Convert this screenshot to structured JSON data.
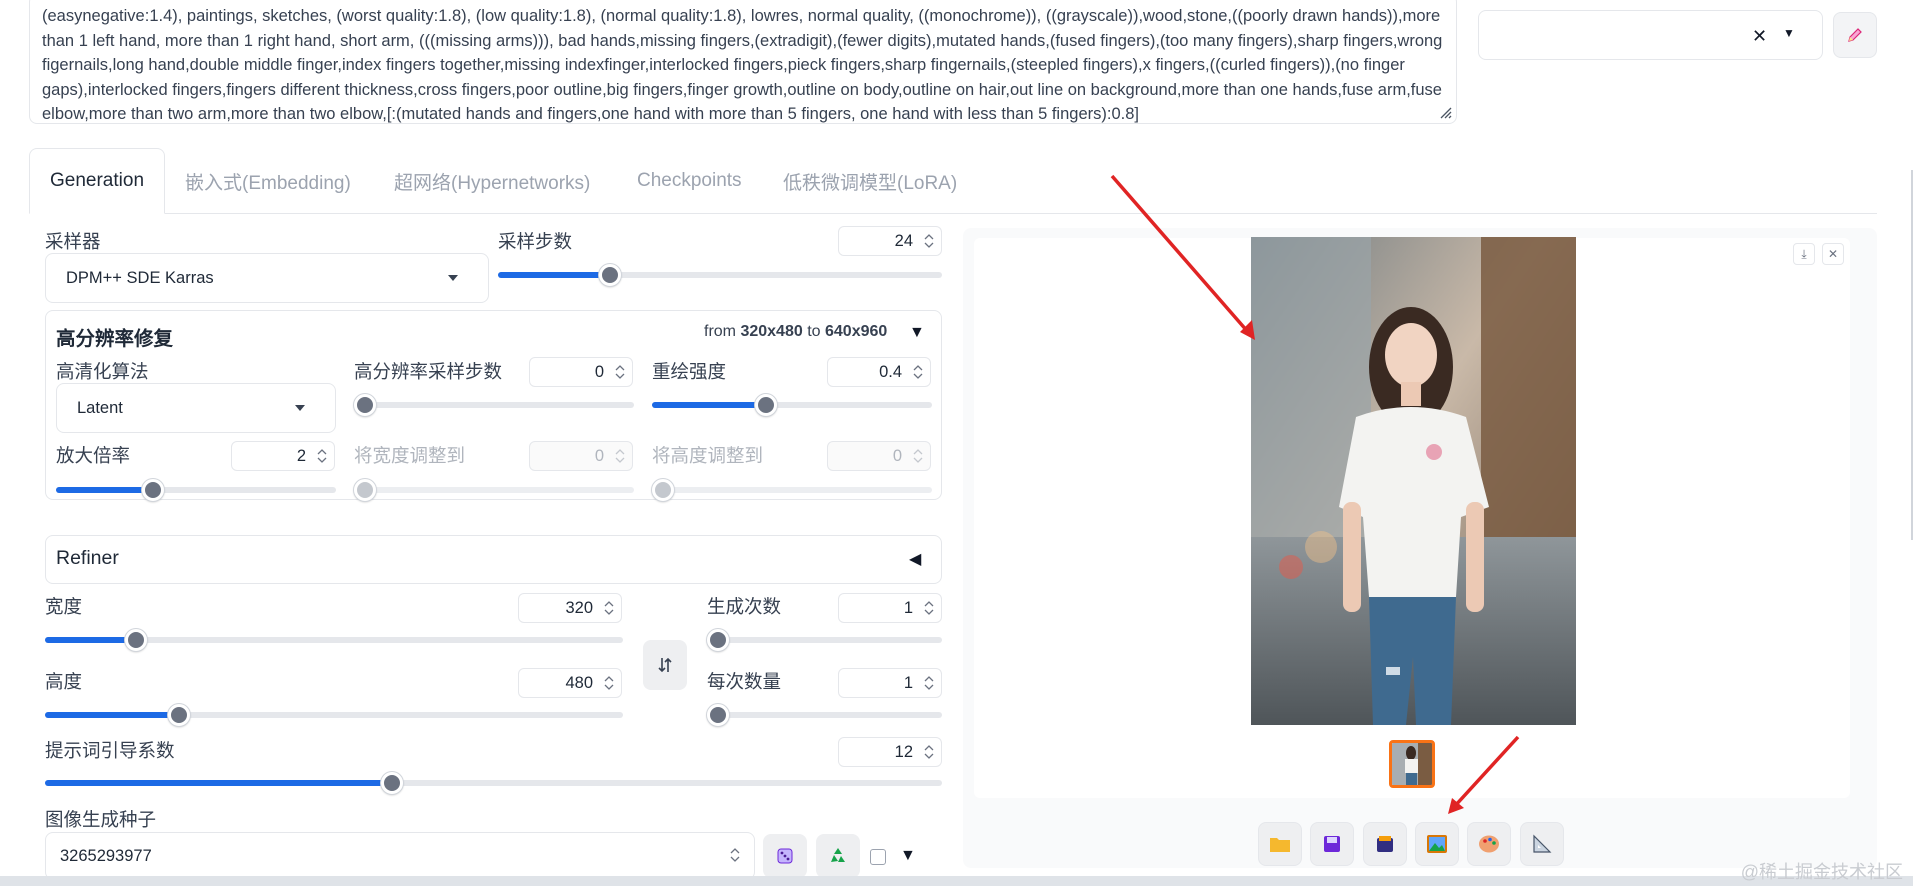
{
  "prompt": {
    "negative_text": "(easynegative:1.4), paintings, sketches, (worst quality:1.8), (low quality:1.8), (normal quality:1.8), lowres, normal quality, ((monochrome)), ((grayscale)),wood,stone,((poorly drawn hands)),more than 1 left hand, more than 1 right hand, short arm, (((missing arms))), bad hands,missing fingers,(extradigit),(fewer digits),mutated hands,(fused fingers),(too many fingers),sharp fingers,wrong figernails,long hand,double middle finger,index fingers together,missing indexfinger,interlocked fingers,pieck fingers,sharp fingernails,(steepled fingers),x fingers,((curled fingers)),(no finger gaps),interlocked fingers,fingers different thickness,cross fingers,poor outline,big fingers,finger growth,outline on body,outline on hair,out line on background,more than one hands,fuse arm,fuse elbow,more than two arm,more than two elbow,[:(mutated hands and fingers,one hand with more than 5 fingers, one hand with less than 5 fingers):0.8]"
  },
  "tabs": [
    {
      "label": "Generation",
      "active": true
    },
    {
      "label": "嵌入式(Embedding)",
      "active": false
    },
    {
      "label": "超网络(Hypernetworks)",
      "active": false
    },
    {
      "label": "Checkpoints",
      "active": false
    },
    {
      "label": "低秩微调模型(LoRA)",
      "active": false
    }
  ],
  "sampler": {
    "label": "采样器",
    "value": "DPM++ SDE Karras"
  },
  "steps": {
    "label": "采样步数",
    "value": "24",
    "fraction": 0.24
  },
  "hires": {
    "title": "高分辨率修复",
    "from_prefix": "from",
    "from_value": "320x480",
    "to_prefix": "to",
    "to_value": "640x960",
    "upscaler": {
      "label": "高清化算法",
      "value": "Latent"
    },
    "hires_steps": {
      "label": "高分辨率采样步数",
      "value": "0",
      "fraction": 0.0
    },
    "denoise": {
      "label": "重绘强度",
      "value": "0.4",
      "fraction": 0.4
    },
    "upscale_by": {
      "label": "放大倍率",
      "value": "2",
      "fraction": 0.333
    },
    "resize_width": {
      "label": "将宽度调整到",
      "value": "0",
      "fraction": 0.0
    },
    "resize_height": {
      "label": "将高度调整到",
      "value": "0",
      "fraction": 0.0
    }
  },
  "refiner": {
    "title": "Refiner"
  },
  "width": {
    "label": "宽度",
    "value": "320",
    "fraction": 0.143
  },
  "height": {
    "label": "高度",
    "value": "480",
    "fraction": 0.222
  },
  "batch_count": {
    "label": "生成次数",
    "value": "1",
    "fraction": 0.0
  },
  "batch_size": {
    "label": "每次数量",
    "value": "1",
    "fraction": 0.0
  },
  "cfg": {
    "label": "提示词引导系数",
    "value": "12",
    "fraction": 0.384
  },
  "seed": {
    "label": "图像生成种子",
    "value": "3265293977"
  },
  "watermark": "@稀土掘金技术社区",
  "colors": {
    "accent": "#1d6ae5",
    "thumb_border": "#f97316",
    "arrow": "#e02424"
  },
  "icons": [
    "pencil-icon",
    "swap-icon",
    "dice-icon",
    "recycle-icon",
    "folder-icon",
    "save-icon",
    "zip-icon",
    "image-icon",
    "palette-icon",
    "ruler-icon",
    "download-icon",
    "close-icon"
  ]
}
